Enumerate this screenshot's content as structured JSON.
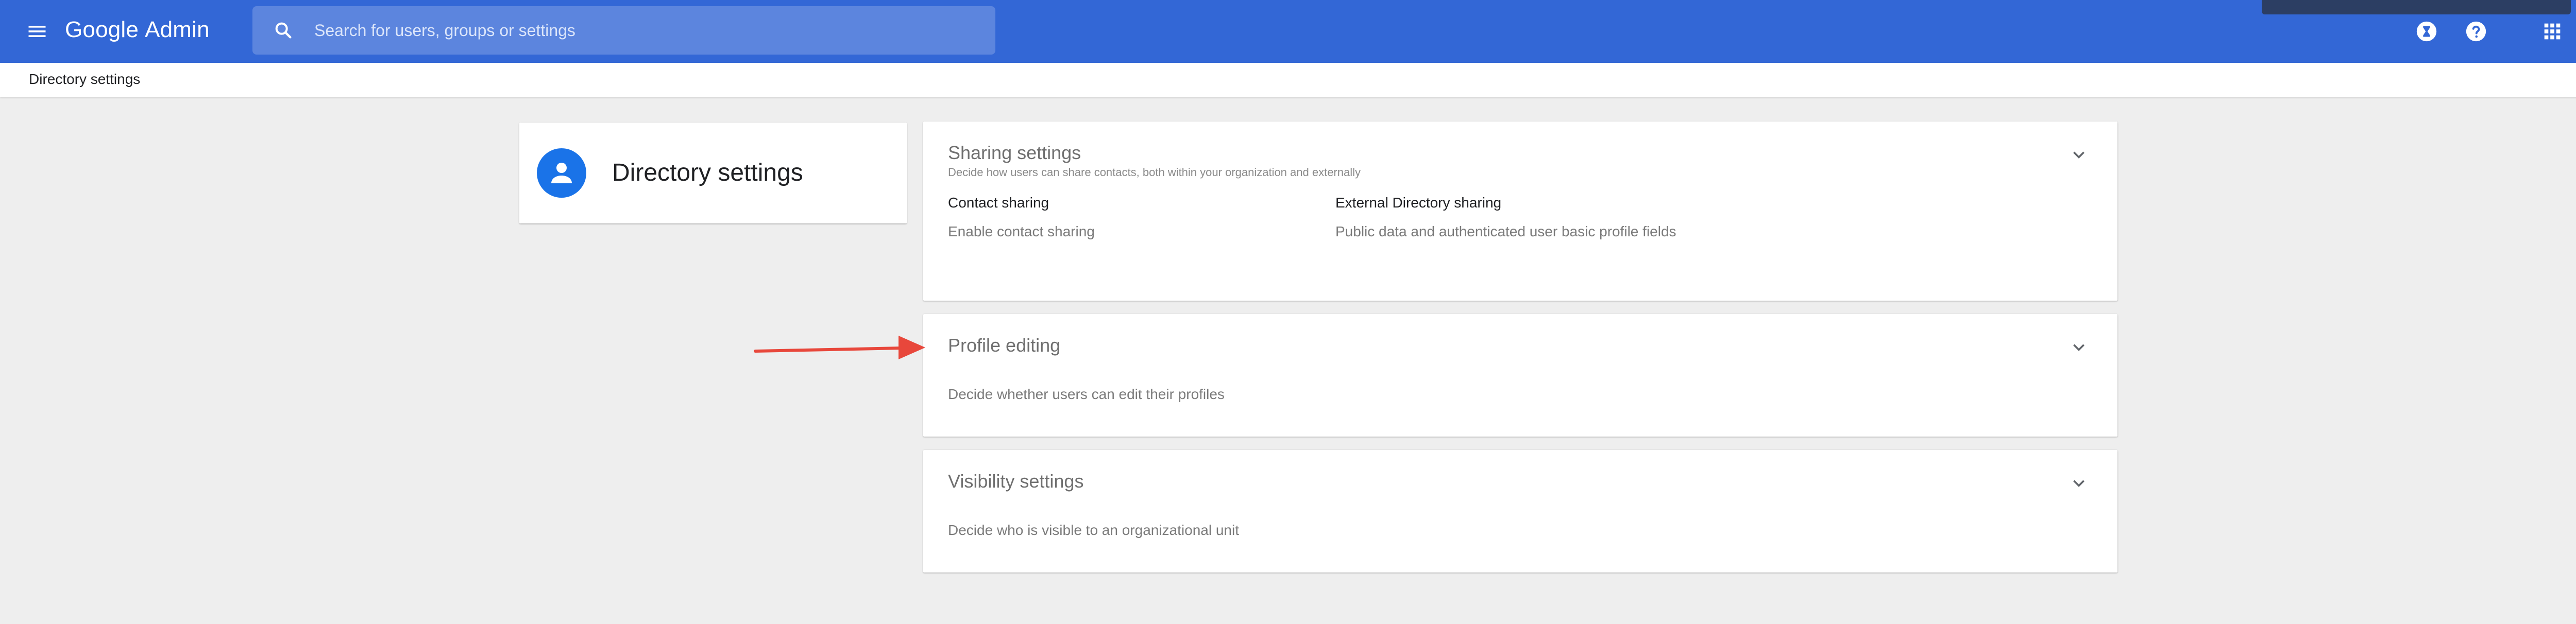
{
  "header": {
    "brand_primary": "Google",
    "brand_secondary": "Admin",
    "search": {
      "placeholder": "Search for users, groups or settings"
    },
    "icons": [
      "menu-icon",
      "search-icon",
      "support-hourglass-icon",
      "help-icon",
      "apps-grid-icon"
    ],
    "accent_color": "#3367d6"
  },
  "breadcrumb": {
    "current": "Directory settings"
  },
  "page": {
    "title": "Directory settings",
    "title_icon": "person-icon",
    "title_icon_color": "#1a73e8"
  },
  "sections": {
    "sharing": {
      "title": "Sharing settings",
      "subtitle": "Decide how users can share contacts, both within your organization and externally",
      "fields": [
        {
          "label": "Contact sharing",
          "value": "Enable contact sharing"
        },
        {
          "label": "External Directory sharing",
          "value": "Public data and authenticated user basic profile fields"
        }
      ]
    },
    "profile": {
      "title": "Profile editing",
      "description": "Decide whether users can edit their profiles"
    },
    "visibility": {
      "title": "Visibility settings",
      "description": "Decide who is visible to an organizational unit"
    }
  },
  "annotation": {
    "arrow_color": "#e8473b"
  }
}
